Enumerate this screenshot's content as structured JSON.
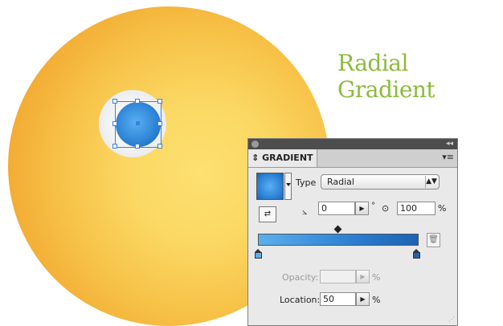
{
  "heading": "Radial Gradient",
  "panel": {
    "title": "GRADIENT",
    "collapse_glyph": "◂◂",
    "menu_glyph": "▾≡",
    "type_label": "Type",
    "type_value": "Radial",
    "angle_value": "0",
    "degree_sign": "°",
    "aspect_value": "100",
    "aspect_unit": "%",
    "opacity_label": "Opacity:",
    "opacity_value": "",
    "opacity_unit": "%",
    "location_label": "Location:",
    "location_value": "50",
    "location_unit": "%"
  },
  "colors": {
    "heading": "#8cba3c",
    "selection": "#3b7fe3",
    "gradient_start": "#5ab0ee",
    "gradient_end": "#1e62b4",
    "sphere_light": "#fde070",
    "sphere_dark": "#ee9a25"
  },
  "icons": {
    "reverse": "reverse-gradient-icon",
    "angle": "angle-icon",
    "aspect": "aspect-ratio-icon",
    "trash": "trash-icon"
  }
}
